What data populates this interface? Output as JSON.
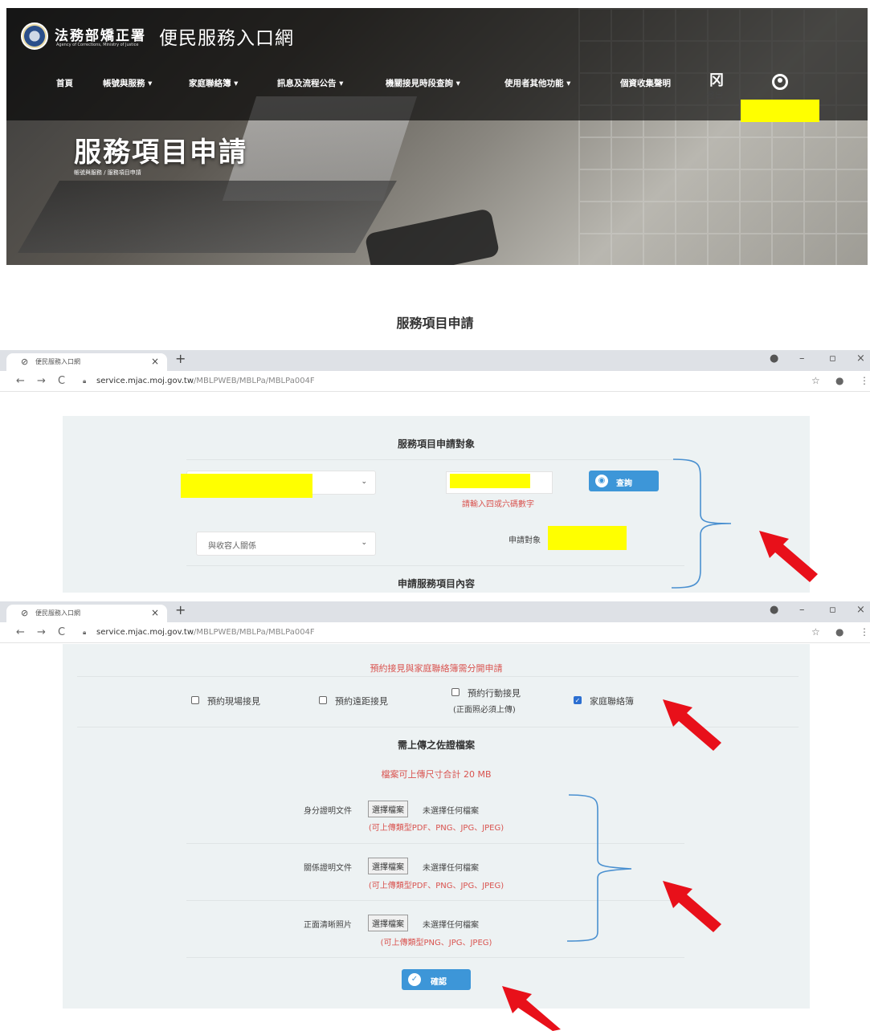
{
  "header": {
    "agency_name": "法務部矯正署",
    "agency_sub": "Agency of Corrections, Ministry of Justice",
    "site_title": "便民服務入口網",
    "nav": [
      {
        "label": "首頁"
      },
      {
        "label": "帳號與服務 ▾"
      },
      {
        "label": "家庭聯絡簿 ▾"
      },
      {
        "label": "訊息及流程公告 ▾"
      },
      {
        "label": "機關接見時段查詢 ▾"
      },
      {
        "label": "使用者其他功能 ▾"
      },
      {
        "label": "個資收集聲明"
      }
    ],
    "logout_label": "登出"
  },
  "hero": {
    "title": "服務項目申請",
    "breadcrumb": "帳號與服務 / 服務項目申請"
  },
  "page_heading": "服務項目申請",
  "browser": {
    "tab_title": "便民服務入口網",
    "url_domain": "service.mjac.moj.gov.tw",
    "url_path": "/MBLPWEB/MBLPa/MBLPa004F"
  },
  "form_target": {
    "title": "服務項目申請對象",
    "search_label": "查詢",
    "digits_hint": "請輸入四或六碼數字",
    "relation_placeholder": "與收容人關係",
    "applicant_label": "申請對象",
    "content_title": "申請服務項目內容"
  },
  "form_services": {
    "separate_notice": "預約接見與家庭聯絡簿需分開申請",
    "options": [
      {
        "label": "預約現場接見",
        "checked": false
      },
      {
        "label": "預約遠距接見",
        "checked": false
      },
      {
        "label": "預約行動接見",
        "sub": "(正面照必須上傳)",
        "checked": false
      },
      {
        "label": "家庭聯絡簿",
        "checked": true
      }
    ],
    "upload_title": "需上傳之佐證檔案",
    "size_limit": "檔案可上傳尺寸合計 20 MB",
    "files": [
      {
        "label": "身分證明文件",
        "button": "選擇檔案",
        "status": "未選擇任何檔案",
        "types": "(可上傳類型PDF、PNG、JPG、JPEG)"
      },
      {
        "label": "關係證明文件",
        "button": "選擇檔案",
        "status": "未選擇任何檔案",
        "types": "(可上傳類型PDF、PNG、JPG、JPEG)"
      },
      {
        "label": "正面清晰照片",
        "button": "選擇檔案",
        "status": "未選擇任何檔案",
        "types": "(可上傳類型PNG、JPG、JPEG)"
      }
    ],
    "confirm_label": "確認"
  },
  "colors": {
    "accent": "#3d96d8",
    "annotation_red": "#e8101a",
    "redaction": "#ffff00",
    "panel_bg": "#edf2f3"
  }
}
